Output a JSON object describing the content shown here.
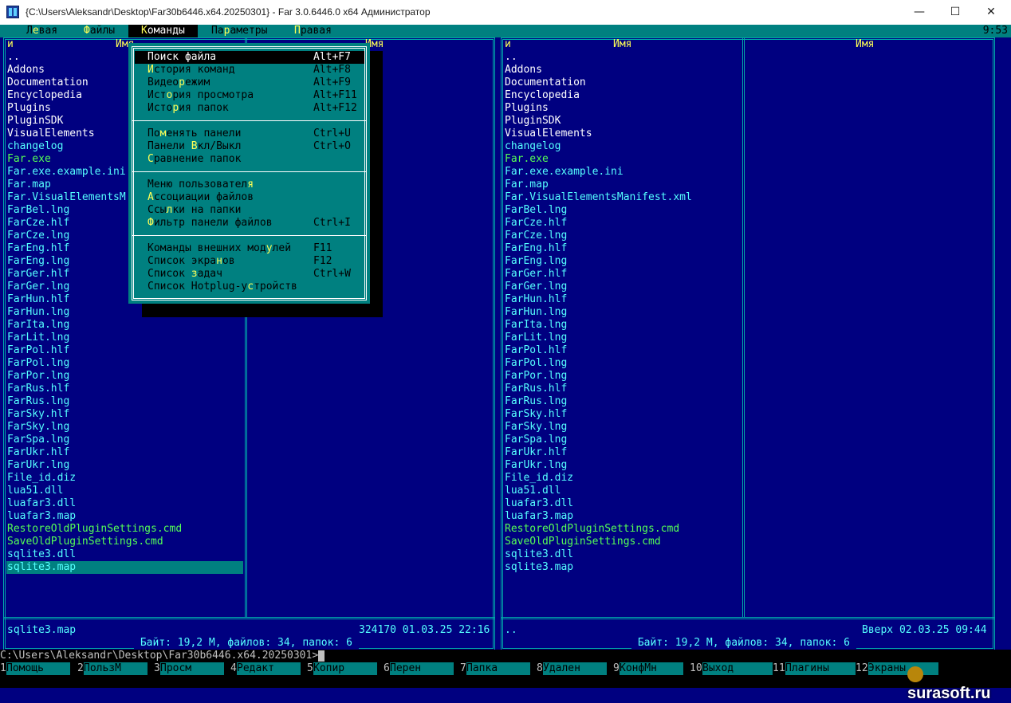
{
  "window": {
    "title": "{C:\\Users\\Aleksandr\\Desktop\\Far30b6446.x64.20250301} - Far 3.0.6446.0 x64 Администратор",
    "minimize": "—",
    "maximize": "☐",
    "close": "✕"
  },
  "menubar": {
    "items": [
      {
        "label": "Левая",
        "hot": 1
      },
      {
        "label": "Файлы",
        "hot": 0
      },
      {
        "label": "Команды",
        "hot": 0
      },
      {
        "label": "Параметры",
        "hot": 2
      },
      {
        "label": "Правая",
        "hot": 0
      }
    ],
    "active_index": 2,
    "clock": "9:53"
  },
  "left_panel": {
    "col_headers": [
      "и",
      "Имя",
      "Имя"
    ],
    "files": [
      {
        "name": "..",
        "type": "dir"
      },
      {
        "name": "Addons",
        "type": "dir"
      },
      {
        "name": "Documentation",
        "type": "dir"
      },
      {
        "name": "Encyclopedia",
        "type": "dir"
      },
      {
        "name": "Plugins",
        "type": "dir"
      },
      {
        "name": "PluginSDK",
        "type": "dir"
      },
      {
        "name": "VisualElements",
        "type": "dir"
      },
      {
        "name": "changelog",
        "type": "txt"
      },
      {
        "name": "Far.exe",
        "type": "exe"
      },
      {
        "name": "Far.exe.example.ini",
        "type": "txt"
      },
      {
        "name": "Far.map",
        "type": "txt"
      },
      {
        "name": "Far.VisualElementsM",
        "type": "txt"
      },
      {
        "name": "FarBel.lng",
        "type": "txt"
      },
      {
        "name": "FarCze.hlf",
        "type": "txt"
      },
      {
        "name": "FarCze.lng",
        "type": "txt"
      },
      {
        "name": "FarEng.hlf",
        "type": "txt"
      },
      {
        "name": "FarEng.lng",
        "type": "txt"
      },
      {
        "name": "FarGer.hlf",
        "type": "txt"
      },
      {
        "name": "FarGer.lng",
        "type": "txt"
      },
      {
        "name": "FarHun.hlf",
        "type": "txt"
      },
      {
        "name": "FarHun.lng",
        "type": "txt"
      },
      {
        "name": "FarIta.lng",
        "type": "txt"
      },
      {
        "name": "FarLit.lng",
        "type": "txt"
      },
      {
        "name": "FarPol.hlf",
        "type": "txt"
      },
      {
        "name": "FarPol.lng",
        "type": "txt"
      },
      {
        "name": "FarPor.lng",
        "type": "txt"
      },
      {
        "name": "FarRus.hlf",
        "type": "txt"
      },
      {
        "name": "FarRus.lng",
        "type": "txt"
      },
      {
        "name": "FarSky.hlf",
        "type": "txt"
      },
      {
        "name": "FarSky.lng",
        "type": "txt"
      },
      {
        "name": "FarSpa.lng",
        "type": "txt"
      },
      {
        "name": "FarUkr.hlf",
        "type": "txt"
      },
      {
        "name": "FarUkr.lng",
        "type": "txt"
      },
      {
        "name": "File_id.diz",
        "type": "txt"
      },
      {
        "name": "lua51.dll",
        "type": "txt"
      },
      {
        "name": "luafar3.dll",
        "type": "txt"
      },
      {
        "name": "luafar3.map",
        "type": "txt"
      },
      {
        "name": "RestoreOldPluginSettings.cmd",
        "type": "exe"
      },
      {
        "name": "SaveOldPluginSettings.cmd",
        "type": "exe"
      },
      {
        "name": "sqlite3.dll",
        "type": "txt"
      },
      {
        "name": "sqlite3.map",
        "type": "txt",
        "selected": true
      }
    ],
    "status_name": "sqlite3.map",
    "status_info": "324170 01.03.25 22:16",
    "summary": " Байт: 19,2 М, файлов: 34, папок: 6 "
  },
  "right_panel": {
    "col_headers": [
      "и",
      "Имя",
      "Имя"
    ],
    "files": [
      {
        "name": "..",
        "type": "dir"
      },
      {
        "name": "Addons",
        "type": "dir"
      },
      {
        "name": "Documentation",
        "type": "dir"
      },
      {
        "name": "Encyclopedia",
        "type": "dir"
      },
      {
        "name": "Plugins",
        "type": "dir"
      },
      {
        "name": "PluginSDK",
        "type": "dir"
      },
      {
        "name": "VisualElements",
        "type": "dir"
      },
      {
        "name": "changelog",
        "type": "txt"
      },
      {
        "name": "Far.exe",
        "type": "exe"
      },
      {
        "name": "Far.exe.example.ini",
        "type": "txt"
      },
      {
        "name": "Far.map",
        "type": "txt"
      },
      {
        "name": "Far.VisualElementsManifest.xml",
        "type": "txt"
      },
      {
        "name": "FarBel.lng",
        "type": "txt"
      },
      {
        "name": "FarCze.hlf",
        "type": "txt"
      },
      {
        "name": "FarCze.lng",
        "type": "txt"
      },
      {
        "name": "FarEng.hlf",
        "type": "txt"
      },
      {
        "name": "FarEng.lng",
        "type": "txt"
      },
      {
        "name": "FarGer.hlf",
        "type": "txt"
      },
      {
        "name": "FarGer.lng",
        "type": "txt"
      },
      {
        "name": "FarHun.hlf",
        "type": "txt"
      },
      {
        "name": "FarHun.lng",
        "type": "txt"
      },
      {
        "name": "FarIta.lng",
        "type": "txt"
      },
      {
        "name": "FarLit.lng",
        "type": "txt"
      },
      {
        "name": "FarPol.hlf",
        "type": "txt"
      },
      {
        "name": "FarPol.lng",
        "type": "txt"
      },
      {
        "name": "FarPor.lng",
        "type": "txt"
      },
      {
        "name": "FarRus.hlf",
        "type": "txt"
      },
      {
        "name": "FarRus.lng",
        "type": "txt"
      },
      {
        "name": "FarSky.hlf",
        "type": "txt"
      },
      {
        "name": "FarSky.lng",
        "type": "txt"
      },
      {
        "name": "FarSpa.lng",
        "type": "txt"
      },
      {
        "name": "FarUkr.hlf",
        "type": "txt"
      },
      {
        "name": "FarUkr.lng",
        "type": "txt"
      },
      {
        "name": "File_id.diz",
        "type": "txt"
      },
      {
        "name": "lua51.dll",
        "type": "txt"
      },
      {
        "name": "luafar3.dll",
        "type": "txt"
      },
      {
        "name": "luafar3.map",
        "type": "txt"
      },
      {
        "name": "RestoreOldPluginSettings.cmd",
        "type": "exe"
      },
      {
        "name": "SaveOldPluginSettings.cmd",
        "type": "exe"
      },
      {
        "name": "sqlite3.dll",
        "type": "txt"
      },
      {
        "name": "sqlite3.map",
        "type": "txt"
      }
    ],
    "status_name": "..",
    "status_info": "Вверх 02.03.25 09:44",
    "summary": " Байт: 19,2 М, файлов: 34, папок: 6 "
  },
  "commands_menu": {
    "groups": [
      [
        {
          "label": "Поиск файла",
          "key": "Alt+F7",
          "hot": 0,
          "selected": true
        },
        {
          "label": "История команд",
          "key": "Alt+F8",
          "hot": 0
        },
        {
          "label": "Видеорежим",
          "key": "Alt+F9",
          "hot": 5
        },
        {
          "label": "История просмотра",
          "key": "Alt+F11",
          "hot": 3
        },
        {
          "label": "История папок",
          "key": "Alt+F12",
          "hot": 4
        }
      ],
      [
        {
          "label": "Поменять панели",
          "key": "Ctrl+U",
          "hot": 2
        },
        {
          "label": "Панели Вкл/Выкл",
          "key": "Ctrl+O",
          "hot": 7
        },
        {
          "label": "Сравнение папок",
          "key": "",
          "hot": 0
        }
      ],
      [
        {
          "label": "Меню пользователя",
          "key": "",
          "hot": 16
        },
        {
          "label": "Ассоциации файлов",
          "key": "",
          "hot": 0
        },
        {
          "label": "Ссылки на папки",
          "key": "",
          "hot": 3
        },
        {
          "label": "Фильтр панели файлов",
          "key": "Ctrl+I",
          "hot": 0
        }
      ],
      [
        {
          "label": "Команды внешних модулей",
          "key": "F11",
          "hot": 19
        },
        {
          "label": "Список экранов",
          "key": "F12",
          "hot": 11
        },
        {
          "label": "Список задач",
          "key": "Ctrl+W",
          "hot": 7
        },
        {
          "label": "Список Hotplug-устройств",
          "key": "",
          "hot": 16
        }
      ]
    ]
  },
  "command_line": {
    "prompt": "C:\\Users\\Aleksandr\\Desktop\\Far30b6446.x64.20250301>"
  },
  "keybar": [
    {
      "num": "1",
      "label": "Помощь"
    },
    {
      "num": "2",
      "label": "ПользМ"
    },
    {
      "num": "3",
      "label": "Просм"
    },
    {
      "num": "4",
      "label": "Редакт"
    },
    {
      "num": "5",
      "label": "Копир"
    },
    {
      "num": "6",
      "label": "Перен"
    },
    {
      "num": "7",
      "label": "Папка"
    },
    {
      "num": "8",
      "label": "Удален"
    },
    {
      "num": "9",
      "label": "КонфМн"
    },
    {
      "num": "10",
      "label": "Выход"
    },
    {
      "num": "11",
      "label": "Плагины"
    },
    {
      "num": "12",
      "label": "Экраны"
    }
  ],
  "watermark": "surasoft.ru",
  "colors": {
    "panel_bg": "#000080",
    "frame": "#00aaaa",
    "menu_bg": "#008080",
    "dir": "#ffffff",
    "file": "#55ffff",
    "executable": "#55ff55",
    "header": "#ffff55",
    "hotkey": "#ffff55"
  }
}
